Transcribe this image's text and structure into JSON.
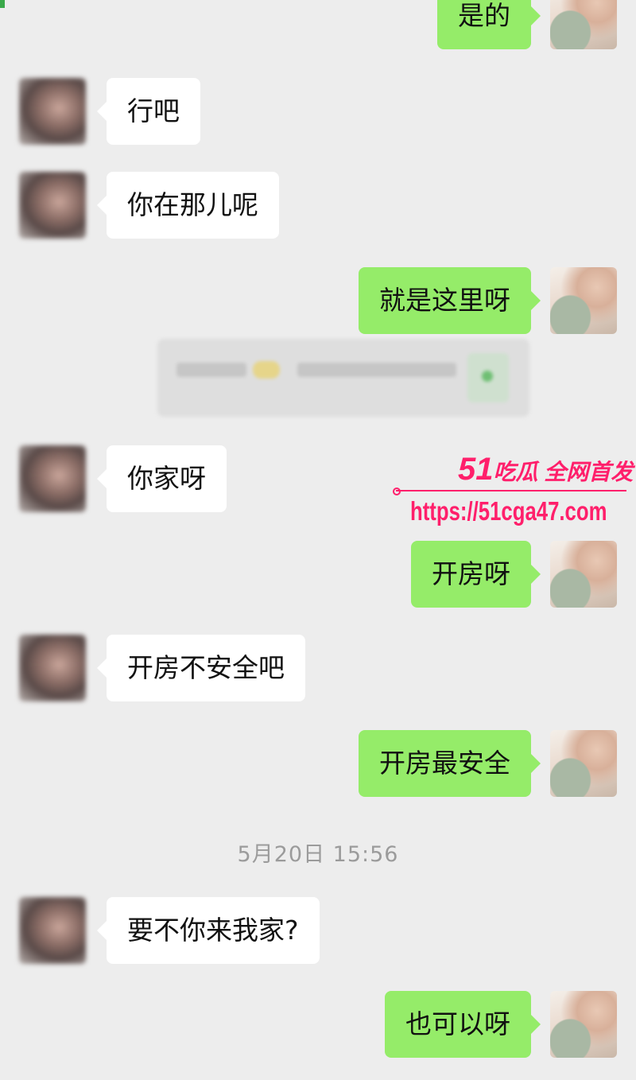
{
  "messages": [
    {
      "side": "right",
      "text": "是的"
    },
    {
      "side": "left",
      "text": "行吧"
    },
    {
      "side": "left",
      "text": "你在那儿呢"
    },
    {
      "side": "right",
      "text": "就是这里呀"
    },
    {
      "side": "left",
      "text": "你家呀"
    },
    {
      "side": "right",
      "text": "开房呀"
    },
    {
      "side": "left",
      "text": "开房不安全吧"
    },
    {
      "side": "right",
      "text": "开房最安全"
    },
    {
      "side": "left",
      "text": "要不你来我家?"
    },
    {
      "side": "right",
      "text": "也可以呀"
    }
  ],
  "timestamp": "5月20日 15:56",
  "watermark": {
    "brand_number": "51",
    "brand_text": "吃瓜 全网首发",
    "url": "https://51cga47.com"
  },
  "colors": {
    "background": "#ededed",
    "my_bubble": "#95ec69",
    "their_bubble": "#ffffff",
    "watermark": "#ff1f6b"
  }
}
